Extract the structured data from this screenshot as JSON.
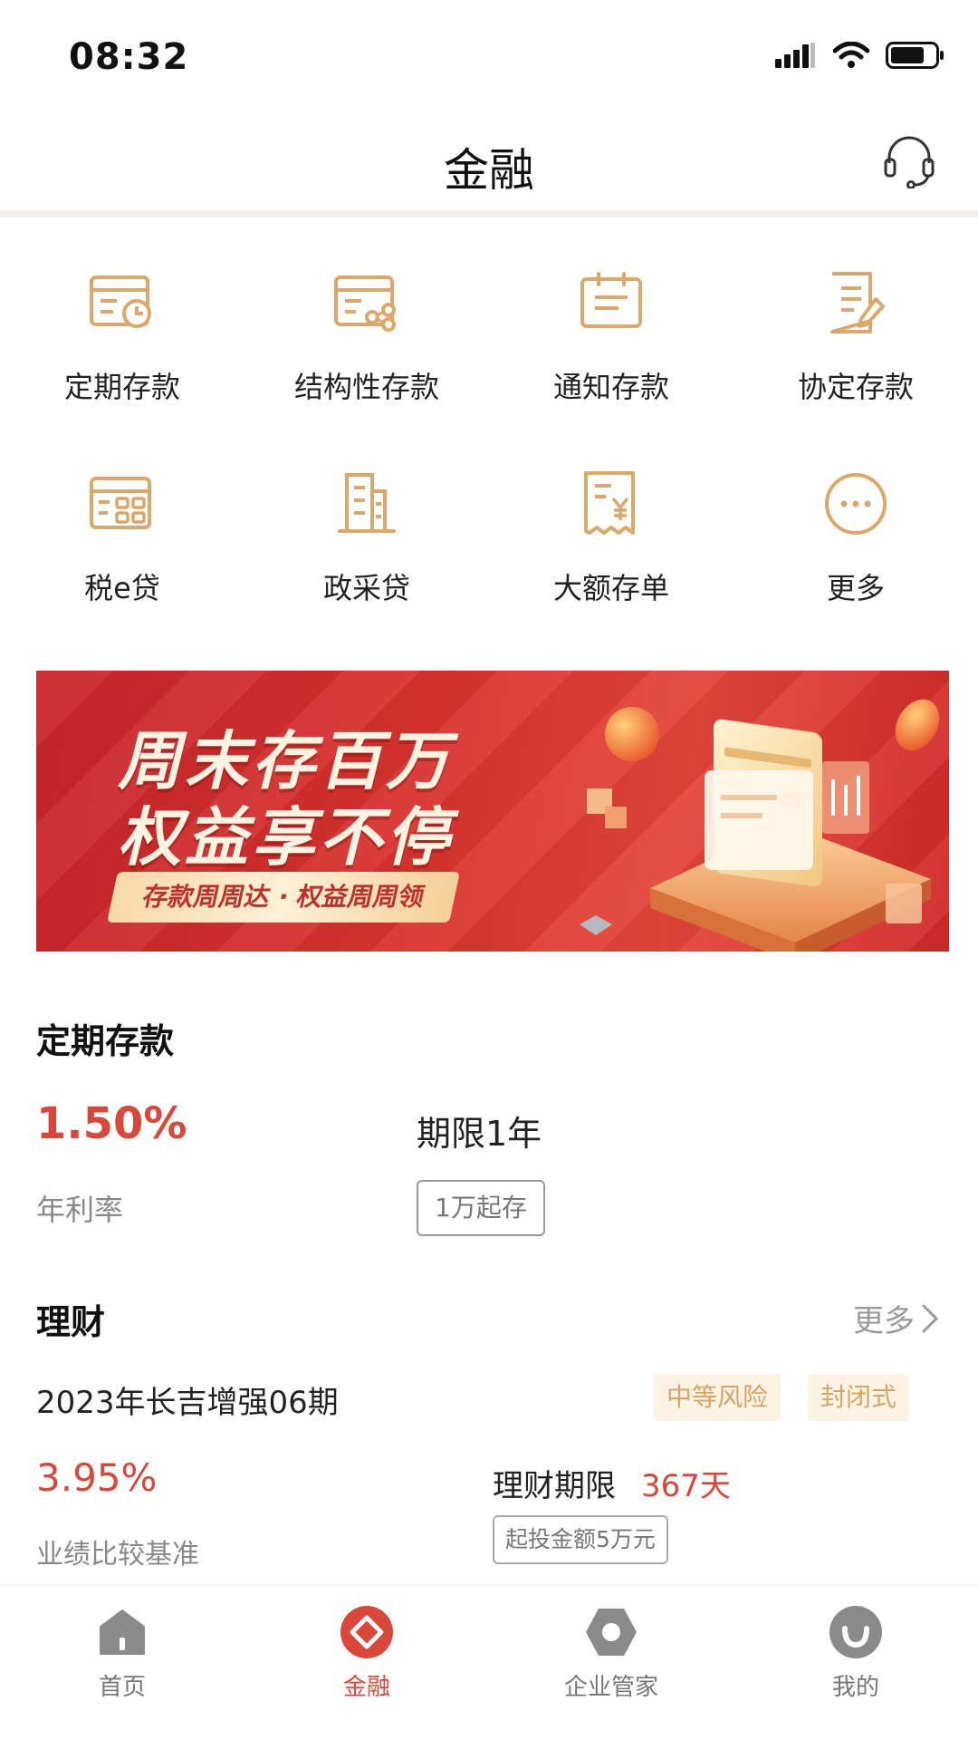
{
  "status_bar": {
    "time": "08:32"
  },
  "nav": {
    "title": "金融"
  },
  "grid": [
    {
      "label": "定期存款",
      "icon": "fixed-deposit-icon"
    },
    {
      "label": "结构性存款",
      "icon": "structured-deposit-icon"
    },
    {
      "label": "通知存款",
      "icon": "call-deposit-icon"
    },
    {
      "label": "协定存款",
      "icon": "agreement-deposit-icon"
    },
    {
      "label": "税e贷",
      "icon": "tax-loan-icon"
    },
    {
      "label": "政采贷",
      "icon": "procurement-loan-icon"
    },
    {
      "label": "大额存单",
      "icon": "large-cd-icon"
    },
    {
      "label": "更多",
      "icon": "more-icon"
    }
  ],
  "banner": {
    "line1": "周末存百万",
    "line2": "权益享不停",
    "tagline": "存款周周达 · 权益周周领"
  },
  "deposit": {
    "title": "定期存款",
    "rate": "1.50%",
    "rate_label": "年利率",
    "term": "期限1年",
    "min_amount": "1万起存"
  },
  "wealth": {
    "title": "理财",
    "more": "更多",
    "product": {
      "name": "2023年长吉增强06期",
      "tags": [
        "中等风险",
        "封闭式"
      ],
      "rate": "3.95%",
      "rate_label": "业绩比较基准",
      "term_label": "理财期限",
      "term_value": "367天",
      "min_amount": "起投金额5万元"
    }
  },
  "tabs": [
    {
      "label": "首页",
      "icon": "home-icon",
      "active": false
    },
    {
      "label": "金融",
      "icon": "finance-icon",
      "active": true
    },
    {
      "label": "企业管家",
      "icon": "enterprise-icon",
      "active": false
    },
    {
      "label": "我的",
      "icon": "profile-icon",
      "active": false
    }
  ],
  "colors": {
    "accent_red": "#d8473a",
    "icon_gold": "#dca86a",
    "tag_text": "#d8a464",
    "tag_bg": "#fdf3e4"
  }
}
